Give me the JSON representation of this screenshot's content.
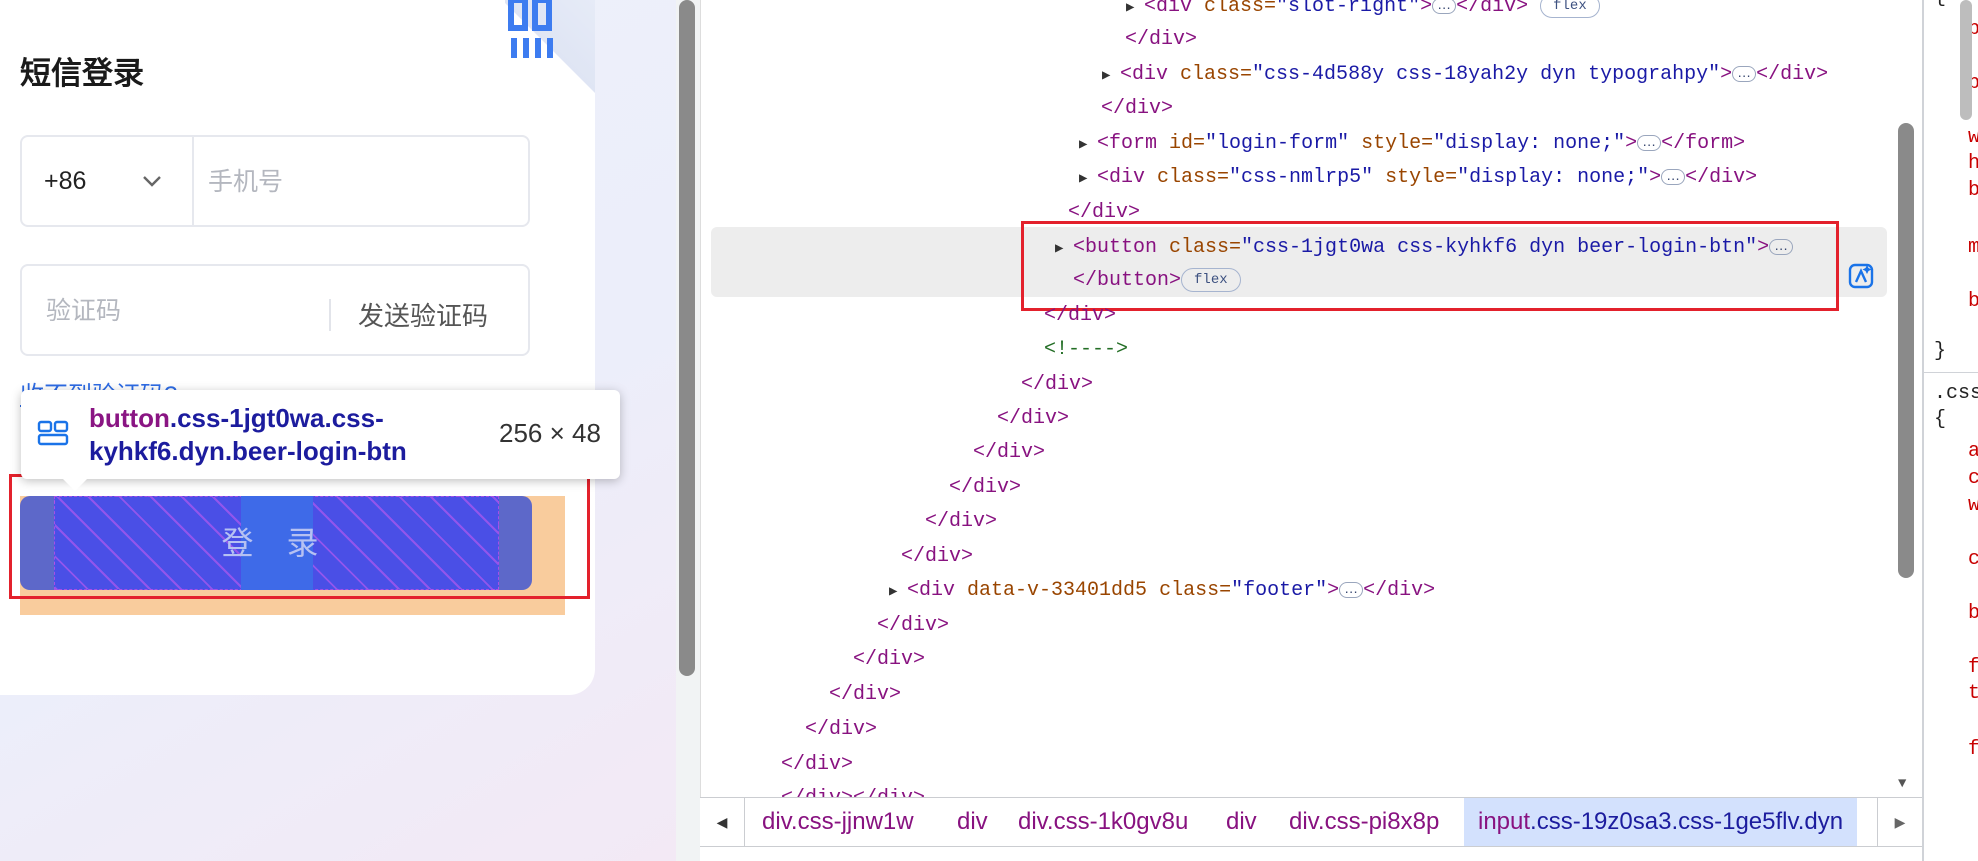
{
  "login": {
    "title": "短信登录",
    "country_code": "+86",
    "phone_placeholder": "手机号",
    "code_placeholder": "验证码",
    "send_code": "发送验证码",
    "no_code_link": "收不到验证码?",
    "login_button": "登 录"
  },
  "tooltip": {
    "tag": "button",
    "classes": ".css-1jgt0wa.css-kyhkf6.dyn.beer-login-btn",
    "size": "256 × 48"
  },
  "elements": {
    "lines": {
      "l0_tag_open": "<div",
      "l0_attr": "class=",
      "l0_val": "\"slot-right\"",
      "l0_close": ">",
      "l0_end": "</div>",
      "l0_badge": "flex",
      "l1": "</div>",
      "l2_tag": "<div",
      "l2_attr": "class=",
      "l2_val": "\"css-4d588y css-18yah2y dyn typograhpy\"",
      "l2_gt": ">",
      "l2_end": "</div>",
      "l3": "</div>",
      "l4_tag": "<form",
      "l4_attr1": "id=",
      "l4_val1": "\"login-form\"",
      "l4_attr2": "style=",
      "l4_val2": "\"display: none;\"",
      "l4_gt": ">",
      "l4_end": "</form>",
      "l5_tag": "<div",
      "l5_attr1": "class=",
      "l5_val1": "\"css-nmlrp5\"",
      "l5_attr2": "style=",
      "l5_val2": "\"display: none;\"",
      "l5_gt": ">",
      "l5_end": "</div>",
      "l6": "</div>",
      "l7_tag": "<button",
      "l7_attr": "class=",
      "l7_val": "\"css-1jgt0wa css-kyhkf6 dyn beer-login-btn\"",
      "l7_gt": ">",
      "l8_end": "</button>",
      "l8_badge": "flex",
      "l9": "</div>",
      "l10": "<!---->",
      "l11": "</div>",
      "l12": "</div>",
      "l13": "</div>",
      "l14": "</div>",
      "l15": "</div>",
      "l16": "</div>",
      "l17_tag": "<div",
      "l17_attr1": "data-v-33401dd5",
      "l17_attr2": "class=",
      "l17_val": "\"footer\"",
      "l17_gt": ">",
      "l17_end": "</div>",
      "l18": "</div>",
      "l19": "</div>",
      "l20": "</div>",
      "l21": "</div>",
      "l22": "</div>",
      "l23": "</div></div>"
    },
    "ellipsis": "…"
  },
  "breadcrumbs": [
    {
      "tag": "div",
      "cls": ".css-jjnw1w"
    },
    {
      "tag": "div",
      "cls": ""
    },
    {
      "tag": "div",
      "cls": ".css-1k0gv8u"
    },
    {
      "tag": "div",
      "cls": ""
    },
    {
      "tag": "div",
      "cls": ".css-pi8x8p"
    }
  ],
  "breadcrumb_active": {
    "tag": "input",
    "cls": ".css-19z0sa3.css-1ge5flv.dyn"
  },
  "styles_pane": {
    "brace_open": "{",
    "brace_close": "}",
    "selector": ".css",
    "props": [
      "p",
      "p",
      "w",
      "h",
      "b",
      "m",
      "b",
      "a",
      "c",
      "w",
      "c",
      "b",
      "f",
      "t",
      "f"
    ]
  },
  "colors": {
    "highlight_border": "#e3212c",
    "tag": "#881280",
    "attr": "#994500",
    "value": "#1a1aa6",
    "link": "#2d6be4"
  },
  "icons": {
    "country_dropdown": "chevron-down-icon",
    "tooltip": "layout-grid-icon",
    "qr": "qr-code-icon",
    "ai": "ai-assistant-icon",
    "nav_left": "triangle-left-icon",
    "nav_right": "triangle-right-icon"
  }
}
